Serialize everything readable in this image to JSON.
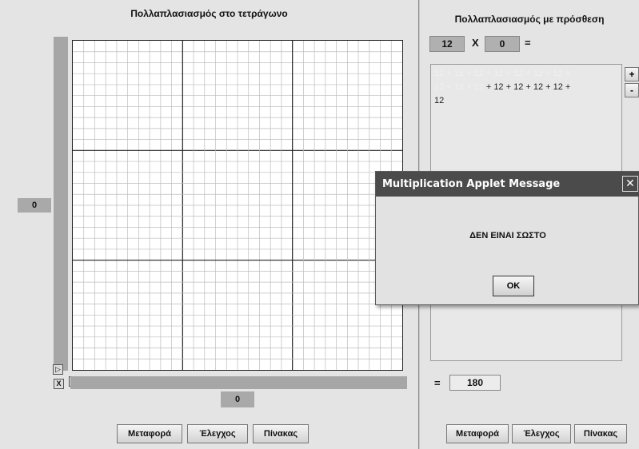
{
  "left": {
    "title": "Πολλαπλασιασμός στο τετράγωνο",
    "vertical_value": "0",
    "horizontal_value": "0",
    "corner_label": "X",
    "grid": {
      "major_divisions": 3,
      "minor_per_major": 10
    },
    "buttons": [
      "Μεταφορά",
      "Έλεγχος",
      "Πίνακας"
    ]
  },
  "right": {
    "title": "Πολλαπλασιασμός με πρόσθεση",
    "multiplicand": "12",
    "times": "X",
    "multiplier": "0",
    "equals": "=",
    "sum_faded_line1": "12 + 12 + 12 + 12 + 12 + 12 + 12 +",
    "sum_faded_line2": "12 + 12 + 12",
    "sum_dark_line2": " + 12 + 12 + 12 + 12 +",
    "sum_line3": "12",
    "plus_label": "+",
    "minus_label": "-",
    "result_equals": "=",
    "result": "180",
    "buttons": [
      "Μεταφορά",
      "Έλεγχος",
      "Πίνακας"
    ]
  },
  "dialog": {
    "title": "Multiplication Applet Message",
    "message": "ΔΕΝ ΕΙΝΑΙ ΣΩΣΤΟ",
    "ok": "OK",
    "close": "✕"
  }
}
